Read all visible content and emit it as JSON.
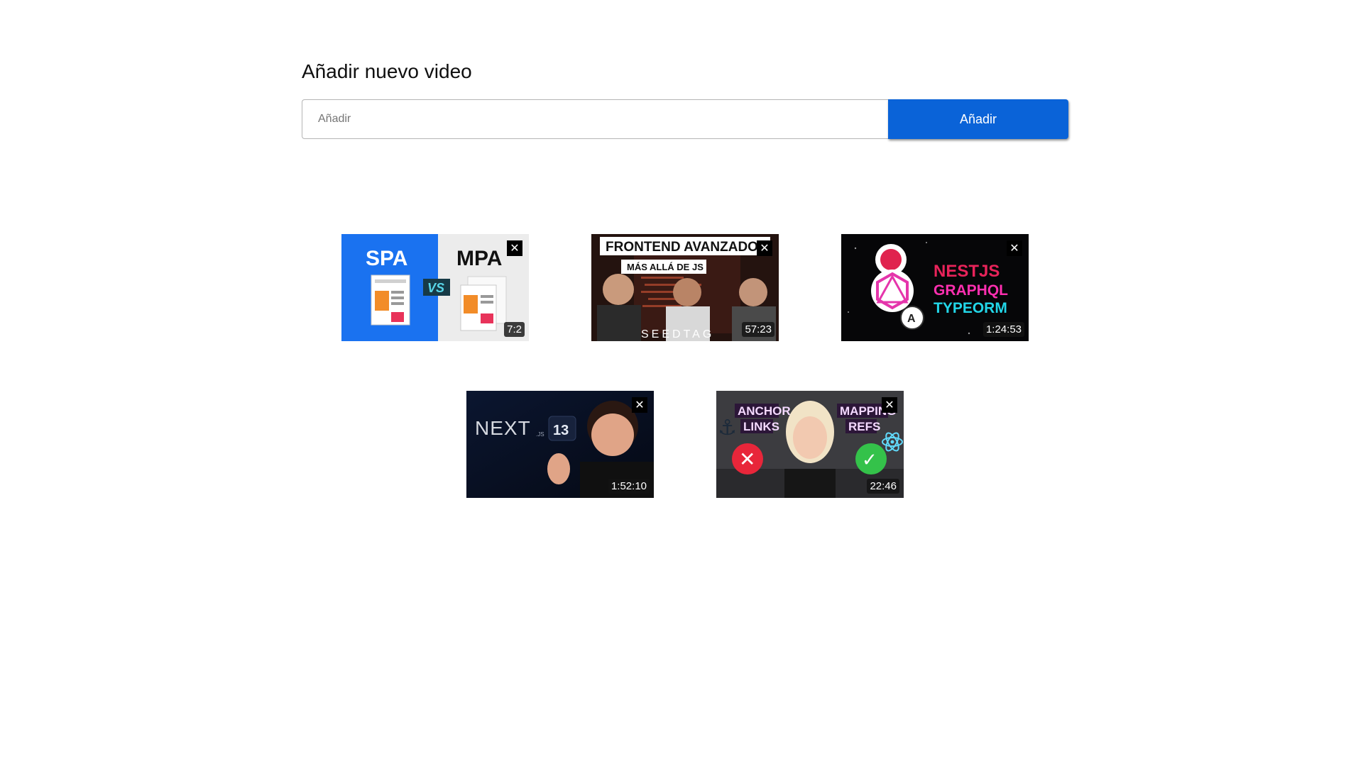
{
  "page": {
    "heading": "Añadir nuevo video"
  },
  "add_form": {
    "placeholder": "Añadir",
    "value": "",
    "button_label": "Añadir"
  },
  "videos": [
    {
      "thumbnail_text": [
        "SPA",
        "MPA",
        "VS"
      ],
      "duration": "7:2",
      "close_label": "✕"
    },
    {
      "thumbnail_text": [
        "FRONTEND AVANZADO",
        "MÁS ALLÁ DE JS",
        "SEEDTAG"
      ],
      "duration": "57:23",
      "close_label": "✕"
    },
    {
      "thumbnail_text": [
        "NESTJS",
        "GRAPHQL",
        "TYPEORM"
      ],
      "duration": "1:24:53",
      "close_label": "✕"
    },
    {
      "thumbnail_text": [
        "NEXT",
        ".JS",
        "13"
      ],
      "duration": "1:52:10",
      "close_label": "✕"
    },
    {
      "thumbnail_text": [
        "ANCHOR",
        "LINKS",
        "MAPPING",
        "REFS"
      ],
      "duration": "22:46",
      "close_label": "✕"
    }
  ],
  "colors": {
    "accent": "#0a63d8",
    "input_border": "#b5b5b5",
    "close_bg": "#000000"
  }
}
